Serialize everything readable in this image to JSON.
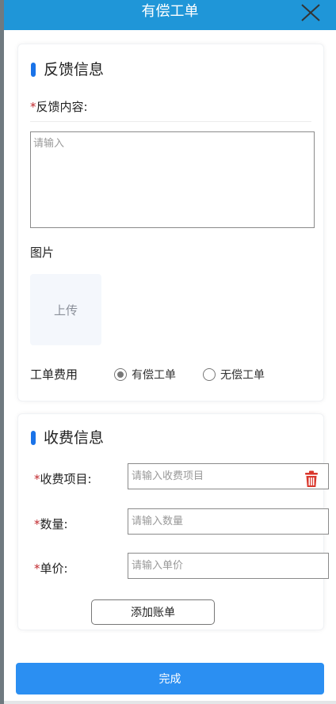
{
  "header": {
    "title": "有偿工单",
    "close_icon": "close-icon",
    "background": "#1f96d8"
  },
  "feedback": {
    "section_title": "反馈信息",
    "required_mark": "*",
    "content_label": "反馈内容:",
    "content_placeholder": "请输入",
    "content_value": "",
    "image_label": "图片",
    "upload_label": "上传",
    "fee_label": "工单费用",
    "fee_options": [
      {
        "label": "有偿工单",
        "checked": true
      },
      {
        "label": "无偿工单",
        "checked": false
      }
    ]
  },
  "charge": {
    "section_title": "收费信息",
    "required_mark": "*",
    "item_label": "收费项目:",
    "item_placeholder": "请输入收费项目",
    "item_value": "",
    "qty_label": "数量:",
    "qty_placeholder": "请输入数量",
    "qty_value": "",
    "price_label": "单价:",
    "price_placeholder": "请输入单价",
    "price_value": "",
    "delete_icon": "trash-icon",
    "add_button": "添加账单"
  },
  "footer": {
    "done_button": "完成",
    "accent": "#2b8ff2"
  }
}
